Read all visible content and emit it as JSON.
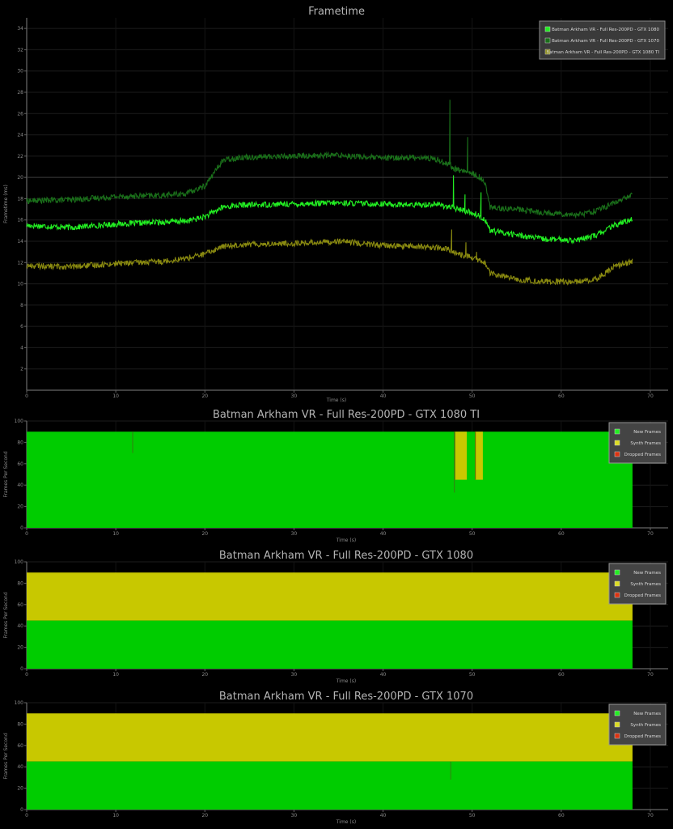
{
  "chart_data": [
    {
      "type": "line",
      "title": "Frametime",
      "xlabel": "Time (s)",
      "ylabel": "Frametime (ms)",
      "xlim": [
        0,
        72
      ],
      "ylim": [
        0,
        35
      ],
      "x_ticks": [
        "0",
        "10",
        "20",
        "30",
        "40",
        "50",
        "60",
        "70"
      ],
      "y_ticks": [
        "2",
        "4",
        "6",
        "8",
        "10",
        "12",
        "14",
        "16",
        "18",
        "20",
        "22",
        "24",
        "26",
        "28",
        "30",
        "32",
        "34"
      ],
      "reference_line": 20,
      "legend_position": "top-right",
      "grid": true,
      "series": [
        {
          "name": "Batman Arkham VR - Full Res-200PD - GTX 1080",
          "color": "#22ee22",
          "x": [
            0,
            5,
            10,
            15,
            18,
            20,
            22,
            24,
            30,
            35,
            40,
            44,
            46,
            47.5,
            48,
            49.5,
            50.5,
            51.5,
            52,
            55,
            58,
            62,
            64,
            66,
            68
          ],
          "values": [
            15.5,
            15.3,
            15.6,
            15.8,
            15.9,
            16.3,
            17.2,
            17.4,
            17.5,
            17.6,
            17.5,
            17.4,
            17.5,
            17.2,
            17.1,
            16.8,
            16.5,
            16.0,
            15.0,
            14.6,
            14.2,
            14.1,
            14.6,
            15.5,
            16.1
          ],
          "spikes": [
            {
              "x": 47.9,
              "value": 20.2
            },
            {
              "x": 49.2,
              "value": 18.4
            },
            {
              "x": 51.0,
              "value": 18.6
            }
          ]
        },
        {
          "name": "Batman Arkham VR - Full Res-200PD - GTX 1070",
          "color": "#1a6f1a",
          "x": [
            0,
            5,
            10,
            15,
            18,
            20,
            22,
            24,
            30,
            35,
            40,
            44,
            46,
            47.5,
            48,
            49.5,
            50.5,
            51.5,
            52,
            55,
            58,
            62,
            64,
            66,
            68
          ],
          "values": [
            17.8,
            17.9,
            18.2,
            18.3,
            18.5,
            19.2,
            21.6,
            21.9,
            22.0,
            22.1,
            21.8,
            21.9,
            21.7,
            21.2,
            20.8,
            20.5,
            20.2,
            19.5,
            17.2,
            17.0,
            16.7,
            16.5,
            16.9,
            17.6,
            18.4
          ],
          "spikes": [
            {
              "x": 47.5,
              "value": 27.3
            },
            {
              "x": 49.5,
              "value": 23.8
            },
            {
              "x": 50.8,
              "value": 20.3
            }
          ]
        },
        {
          "name": "Batman Arkham VR - Full Res-200PD - GTX 1080 TI",
          "color": "#8a8a10",
          "x": [
            0,
            5,
            10,
            15,
            18,
            20,
            22,
            24,
            30,
            35,
            40,
            44,
            46,
            47.5,
            48,
            49.5,
            50.5,
            51.5,
            52,
            55,
            58,
            62,
            64,
            66,
            68
          ],
          "values": [
            11.7,
            11.6,
            11.9,
            12.1,
            12.4,
            12.8,
            13.5,
            13.7,
            13.8,
            14.0,
            13.6,
            13.5,
            13.4,
            13.2,
            12.9,
            12.6,
            12.3,
            11.9,
            11.0,
            10.4,
            10.2,
            10.2,
            10.5,
            11.6,
            12.1
          ],
          "spikes": [
            {
              "x": 47.7,
              "value": 15.1
            },
            {
              "x": 49.3,
              "value": 13.9
            },
            {
              "x": 50.5,
              "value": 13.0
            }
          ]
        }
      ]
    },
    {
      "type": "area",
      "title": "Batman Arkham VR - Full Res-200PD - GTX 1080 TI",
      "xlabel": "Time (s)",
      "ylabel": "Frames Per Second",
      "xlim": [
        0,
        72
      ],
      "ylim": [
        0,
        100
      ],
      "x_ticks": [
        "0",
        "10",
        "20",
        "30",
        "40",
        "50",
        "60",
        "70"
      ],
      "y_ticks": [
        "0",
        "20",
        "40",
        "60",
        "80",
        "100"
      ],
      "legend_position": "top-right",
      "legend": [
        {
          "label": "New Frames",
          "color": "#22ee22"
        },
        {
          "label": "Synth Frames",
          "color": "#dddd22"
        },
        {
          "label": "Dropped Frames",
          "color": "#dd3311"
        }
      ],
      "x_end": 68,
      "total_fps": 90,
      "new_frames_fps": 90,
      "synth_segments": [
        {
          "from": 48,
          "to": 49.4,
          "new_fps": 45
        },
        {
          "from": 50.3,
          "to": 51.2,
          "new_fps": 45
        }
      ],
      "dips": [
        {
          "x": 11.9,
          "value": 70
        },
        {
          "x": 48,
          "value": 33
        }
      ]
    },
    {
      "type": "area",
      "title": "Batman Arkham VR - Full Res-200PD - GTX 1080",
      "xlabel": "Time (s)",
      "ylabel": "Frames Per Second",
      "xlim": [
        0,
        72
      ],
      "ylim": [
        0,
        100
      ],
      "x_ticks": [
        "0",
        "10",
        "20",
        "30",
        "40",
        "50",
        "60",
        "70"
      ],
      "y_ticks": [
        "0",
        "20",
        "40",
        "60",
        "80",
        "100"
      ],
      "legend_position": "top-right",
      "legend": [
        {
          "label": "New Frames",
          "color": "#22ee22"
        },
        {
          "label": "Synth Frames",
          "color": "#dddd22"
        },
        {
          "label": "Dropped Frames",
          "color": "#dd3311"
        }
      ],
      "x_end": 68,
      "total_fps": 90,
      "new_frames_fps": 45,
      "synth_segments": [],
      "dips": []
    },
    {
      "type": "area",
      "title": "Batman Arkham VR - Full Res-200PD - GTX 1070",
      "xlabel": "Time (s)",
      "ylabel": "Frames Per Second",
      "xlim": [
        0,
        72
      ],
      "ylim": [
        0,
        100
      ],
      "x_ticks": [
        "0",
        "10",
        "20",
        "30",
        "40",
        "50",
        "60",
        "70"
      ],
      "y_ticks": [
        "0",
        "20",
        "40",
        "60",
        "80",
        "100"
      ],
      "legend_position": "top-right",
      "legend": [
        {
          "label": "New Frames",
          "color": "#22ee22"
        },
        {
          "label": "Synth Frames",
          "color": "#dddd22"
        },
        {
          "label": "Dropped Frames",
          "color": "#dd3311"
        }
      ],
      "x_end": 68,
      "total_fps": 90,
      "new_frames_fps": 45,
      "synth_segments": [],
      "dips": [
        {
          "x": 47.6,
          "value": 28
        }
      ]
    }
  ]
}
